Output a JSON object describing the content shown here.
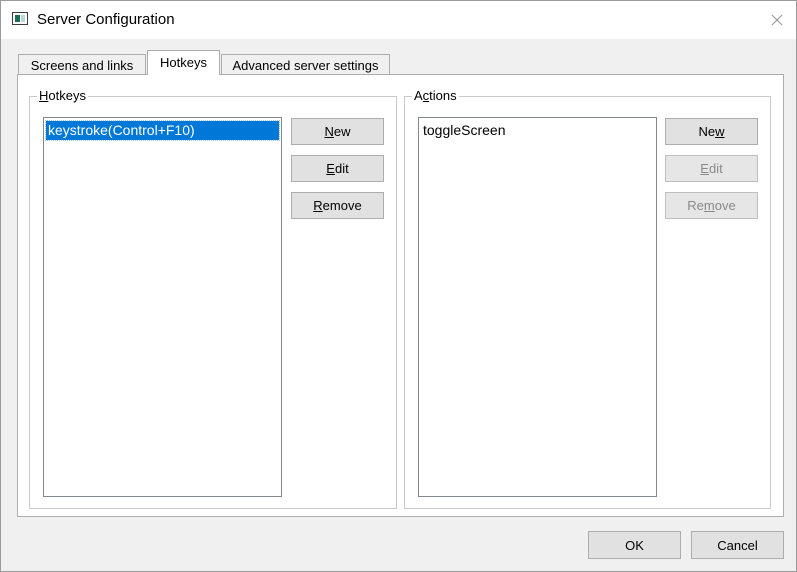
{
  "window": {
    "title": "Server Configuration",
    "close_icon": "close-icon"
  },
  "tabs": [
    {
      "label": "Screens and links",
      "active": false
    },
    {
      "label": "Hotkeys",
      "active": true
    },
    {
      "label": "Advanced server settings",
      "active": false
    }
  ],
  "hotkeys_group": {
    "label_accel": "H",
    "label_rest": "otkeys",
    "items": [
      "keystroke(Control+F10)"
    ],
    "selected_index": 0,
    "new_accel": "N",
    "new_rest": "ew",
    "edit_accel": "E",
    "edit_rest": "dit",
    "remove_accel": "R",
    "remove_rest": "emove"
  },
  "actions_group": {
    "label_pre": "A",
    "label_accel": "c",
    "label_rest": "tions",
    "items": [
      "toggleScreen"
    ],
    "new_pre": "Ne",
    "new_accel": "w",
    "edit_accel": "E",
    "edit_rest": "dit",
    "remove_pre": "Re",
    "remove_accel": "m",
    "remove_rest": "ove"
  },
  "footer": {
    "ok_label": "OK",
    "cancel_label": "Cancel"
  },
  "colors": {
    "selection": "#0078d7",
    "disabled_text": "#8a8a8a"
  }
}
